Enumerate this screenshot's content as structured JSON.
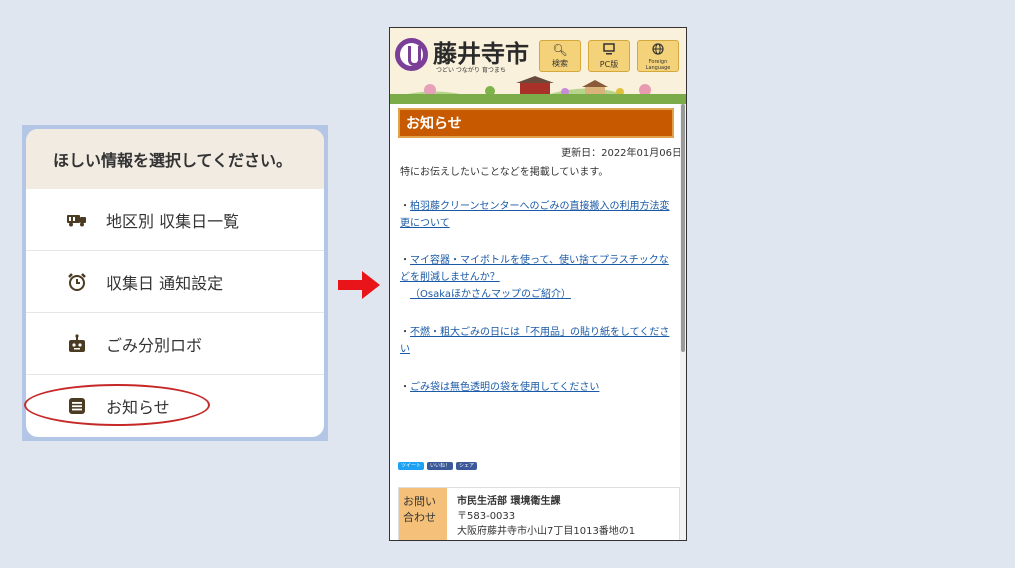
{
  "menu": {
    "heading": "ほしい情報を選択してください。",
    "items": [
      {
        "label": "地区別 収集日一覧",
        "icon": "truck-icon"
      },
      {
        "label": "収集日 通知設定",
        "icon": "alarm-clock-icon"
      },
      {
        "label": "ごみ分別ロボ",
        "icon": "robot-icon"
      },
      {
        "label": "お知らせ",
        "icon": "notice-icon"
      }
    ]
  },
  "site": {
    "name": "藤井寺市",
    "tagline": "つどい つながり 育つまち",
    "buttons": {
      "search": "検索",
      "pc": "PC版",
      "foreign": "Foreign Language"
    }
  },
  "page": {
    "title": "お知らせ",
    "updated": "更新日：2022年01月06日",
    "intro": "特にお伝えしたいことなどを掲載しています。",
    "news": [
      {
        "prefix": "・",
        "link": "柏羽藤クリーンセンターへのごみの直接搬入の利用方法変更について"
      },
      {
        "prefix": "・",
        "link": "マイ容器・マイボトルを使って、使い捨てプラスチックなどを削減しませんか？",
        "sub": "（Osakaほかさんマップのご紹介）"
      },
      {
        "prefix": "・",
        "link": "不燃・粗大ごみの日には「不用品」の貼り紙をしてください"
      },
      {
        "prefix": "・",
        "link": "ごみ袋は無色透明の袋を使用してください"
      }
    ],
    "sns": {
      "tweet": "ツイート",
      "like": "いいね！",
      "share": "シェア"
    }
  },
  "contact": {
    "label": "お問い合わせ",
    "dept": "市民生活部 環境衛生課",
    "postal": "〒583-0033",
    "address": "大阪府藤井寺市小山7丁目1013番地の1"
  },
  "colors": {
    "panel_border": "#b3c6e6",
    "title_bar": "#c75a00",
    "link": "#1a5aa6",
    "arrow": "#e8141a",
    "highlight": "#c62828"
  }
}
